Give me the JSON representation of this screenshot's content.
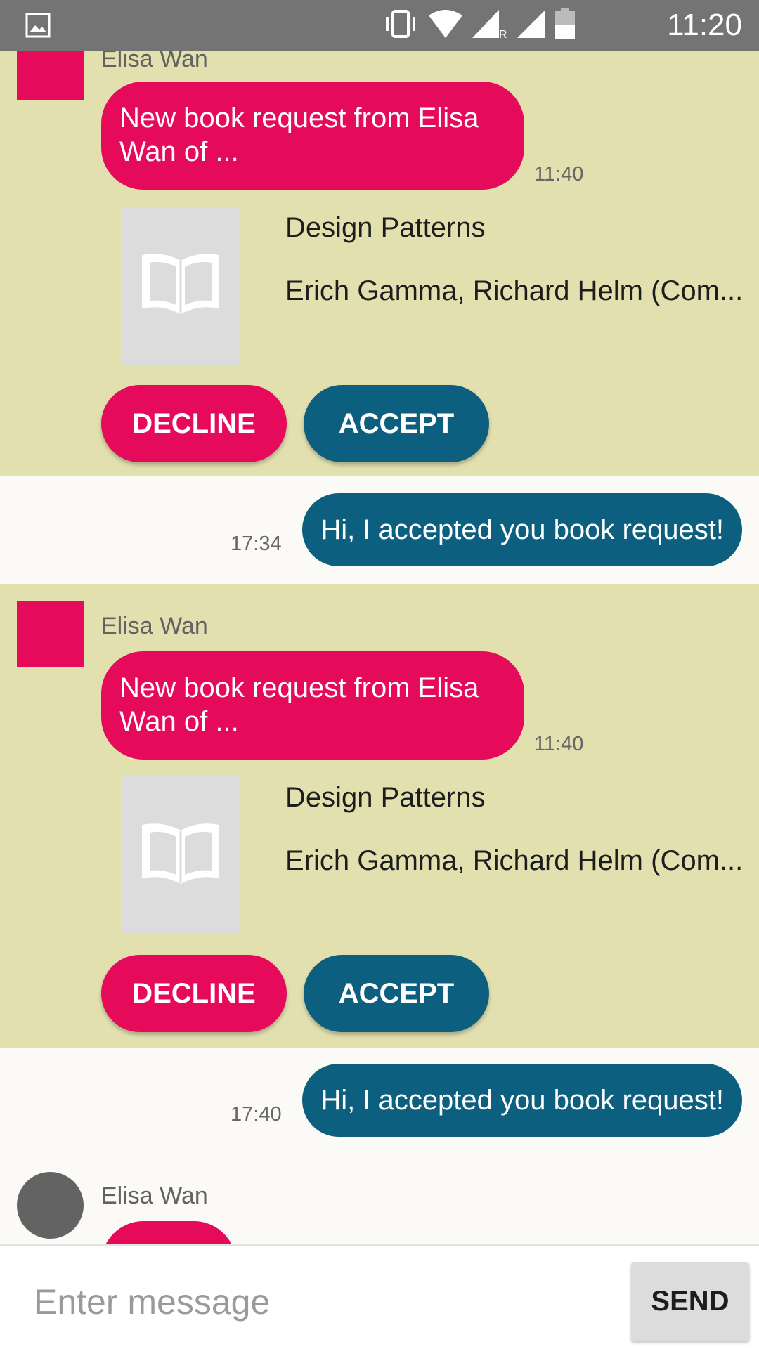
{
  "status_bar": {
    "time": "11:20",
    "icons": [
      "image-icon",
      "vibrate-icon",
      "wifi-icon",
      "signal-roaming-icon",
      "signal-icon",
      "battery-icon"
    ]
  },
  "messages": [
    {
      "type": "book_request",
      "sender": "Elisa Wan",
      "text": "New book request from Elisa Wan of ...",
      "time": "11:40",
      "book": {
        "title": "Design Patterns",
        "authors": "Erich Gamma, Richard Helm (Com..."
      },
      "decline_label": "DECLINE",
      "accept_label": "ACCEPT"
    },
    {
      "type": "outgoing",
      "text": "Hi, I accepted you book request!",
      "time": "17:34"
    },
    {
      "type": "book_request",
      "sender": "Elisa Wan",
      "text": "New book request from Elisa Wan of ...",
      "time": "11:40",
      "book": {
        "title": "Design Patterns",
        "authors": "Erich Gamma, Richard Helm (Com..."
      },
      "decline_label": "DECLINE",
      "accept_label": "ACCEPT"
    },
    {
      "type": "outgoing",
      "text": "Hi, I accepted you book request!",
      "time": "17:40"
    },
    {
      "type": "incoming",
      "sender": "Elisa Wan"
    }
  ],
  "input": {
    "placeholder": "Enter message",
    "send_label": "SEND"
  },
  "colors": {
    "accent_pink": "#e60b5a",
    "accent_blue": "#0c5f7f",
    "request_bg": "#e3e0b0",
    "chat_bg": "#fbfaf6"
  }
}
